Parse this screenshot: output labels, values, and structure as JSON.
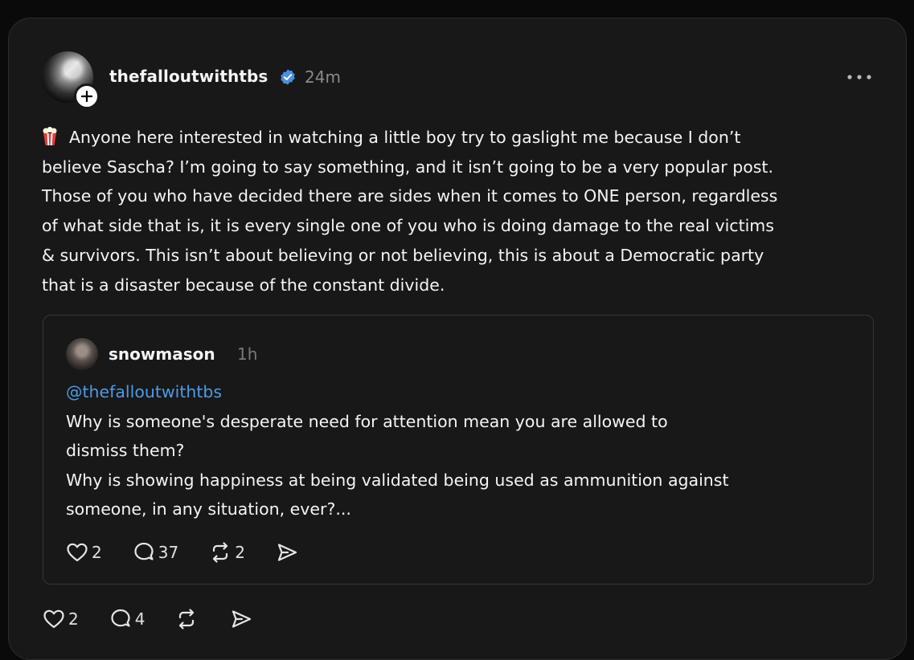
{
  "post": {
    "author": "thefalloutwithtbs",
    "time": "24m",
    "text": "Anyone here interested in watching a little boy try to gaslight me because I don’t believe Sascha? I’m going to say something, and it isn’t going to be a very popular post. Those of you who have decided there are sides when it comes to ONE person, regardless of what side that is, it is every single one of you who is doing damage to the real victims & survivors. This isn’t about believing or not believing, this is about a Democratic party that is a disaster because of the constant divide.",
    "text_lines": [
      "Anyone here interested in watching a little boy try to gaslight me because I don’t",
      "believe Sascha? I’m going to say something, and it isn’t going to be a very popular post.",
      "Those of you who have decided there are sides when it comes to ONE person, regardless",
      "of what side that is, it is every single one of you who is doing damage to the real victims",
      "& survivors. This isn’t about believing or not believing, this is about a Democratic party",
      "that is a disaster because of the constant divide."
    ],
    "emoji": "popcorn-icon",
    "likes": "2",
    "replies": "4"
  },
  "quoted": {
    "author": "snowmason",
    "time": "1h",
    "mention": "@thefalloutwithtbs",
    "lines": [
      "Why is someone's desperate need for attention mean you are allowed to",
      "dismiss them?",
      "Why is showing happiness at being validated being used as ammunition against",
      "someone, in any situation, ever?..."
    ],
    "likes": "2",
    "replies": "37",
    "reposts": "2"
  },
  "colors": {
    "background": "#0a0a0a",
    "card": "#181818",
    "mention": "#4e9ae6",
    "verified": "#4a8fe0",
    "muted": "#8a8a8a"
  }
}
